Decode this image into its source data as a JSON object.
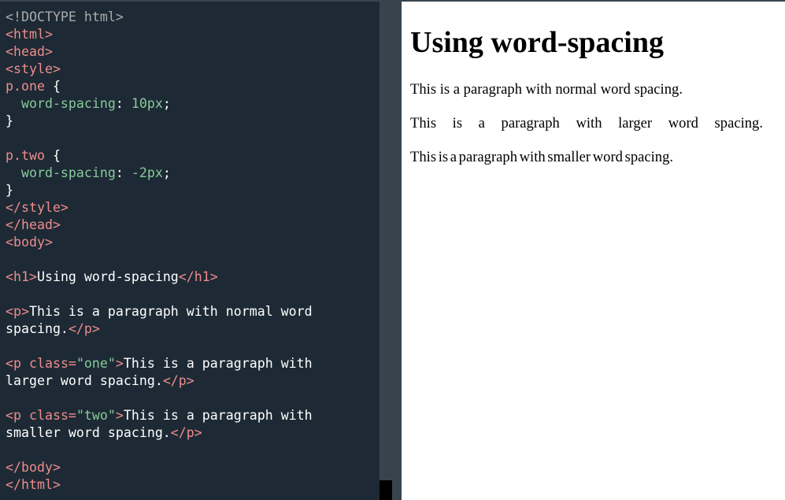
{
  "editor": {
    "lines": [
      [
        {
          "t": "<!DOCTYPE html>",
          "c": "doctype"
        }
      ],
      [
        {
          "t": "<html>",
          "c": "tag"
        }
      ],
      [
        {
          "t": "<head>",
          "c": "tag"
        }
      ],
      [
        {
          "t": "<style>",
          "c": "tag"
        }
      ],
      [
        {
          "t": "p.one",
          "c": "sel"
        },
        {
          "t": " {",
          "c": "punct"
        }
      ],
      [
        {
          "t": "  word-spacing",
          "c": "prop"
        },
        {
          "t": ": ",
          "c": "punct"
        },
        {
          "t": "10px",
          "c": "num"
        },
        {
          "t": ";",
          "c": "punct"
        }
      ],
      [
        {
          "t": "}",
          "c": "punct"
        }
      ],
      [],
      [
        {
          "t": "p.two",
          "c": "sel"
        },
        {
          "t": " {",
          "c": "punct"
        }
      ],
      [
        {
          "t": "  word-spacing",
          "c": "prop"
        },
        {
          "t": ": ",
          "c": "punct"
        },
        {
          "t": "-2px",
          "c": "num"
        },
        {
          "t": ";",
          "c": "punct"
        }
      ],
      [
        {
          "t": "}",
          "c": "punct"
        }
      ],
      [
        {
          "t": "</style>",
          "c": "tag"
        }
      ],
      [
        {
          "t": "</head>",
          "c": "tag"
        }
      ],
      [
        {
          "t": "<body>",
          "c": "tag"
        }
      ],
      [],
      [
        {
          "t": "<h1>",
          "c": "tag"
        },
        {
          "t": "Using word-spacing",
          "c": "text"
        },
        {
          "t": "</h1>",
          "c": "tag"
        }
      ],
      [],
      [
        {
          "t": "<p>",
          "c": "tag"
        },
        {
          "t": "This is a paragraph with normal word",
          "c": "text"
        }
      ],
      [
        {
          "t": "spacing.",
          "c": "text"
        },
        {
          "t": "</p>",
          "c": "tag"
        }
      ],
      [],
      [
        {
          "t": "<p ",
          "c": "tag"
        },
        {
          "t": "class=",
          "c": "attr"
        },
        {
          "t": "\"one\"",
          "c": "attrval"
        },
        {
          "t": ">",
          "c": "tag"
        },
        {
          "t": "This is a paragraph with",
          "c": "text"
        }
      ],
      [
        {
          "t": "larger word spacing.",
          "c": "text"
        },
        {
          "t": "</p>",
          "c": "tag"
        }
      ],
      [],
      [
        {
          "t": "<p ",
          "c": "tag"
        },
        {
          "t": "class=",
          "c": "attr"
        },
        {
          "t": "\"two\"",
          "c": "attrval"
        },
        {
          "t": ">",
          "c": "tag"
        },
        {
          "t": "This is a paragraph with",
          "c": "text"
        }
      ],
      [
        {
          "t": "smaller word spacing.",
          "c": "text"
        },
        {
          "t": "</p>",
          "c": "tag"
        }
      ],
      [],
      [
        {
          "t": "</body>",
          "c": "tag"
        }
      ],
      [
        {
          "t": "</html>",
          "c": "tag"
        }
      ]
    ]
  },
  "preview": {
    "heading": "Using word-spacing",
    "paragraph_normal": "This is a paragraph with normal word spacing.",
    "paragraph_larger": "This is a paragraph with larger word spacing.",
    "paragraph_smaller": "This is a paragraph with smaller word spacing."
  },
  "colors": {
    "editor_bg": "#1d2a35",
    "tag": "#ee8c8c",
    "attr_value": "#88c999",
    "doctype": "#aaaaaa",
    "text": "#ffffff",
    "scrollbar_track": "#38444d",
    "scrollbar_thumb": "#000000",
    "preview_bg": "#ffffff"
  }
}
